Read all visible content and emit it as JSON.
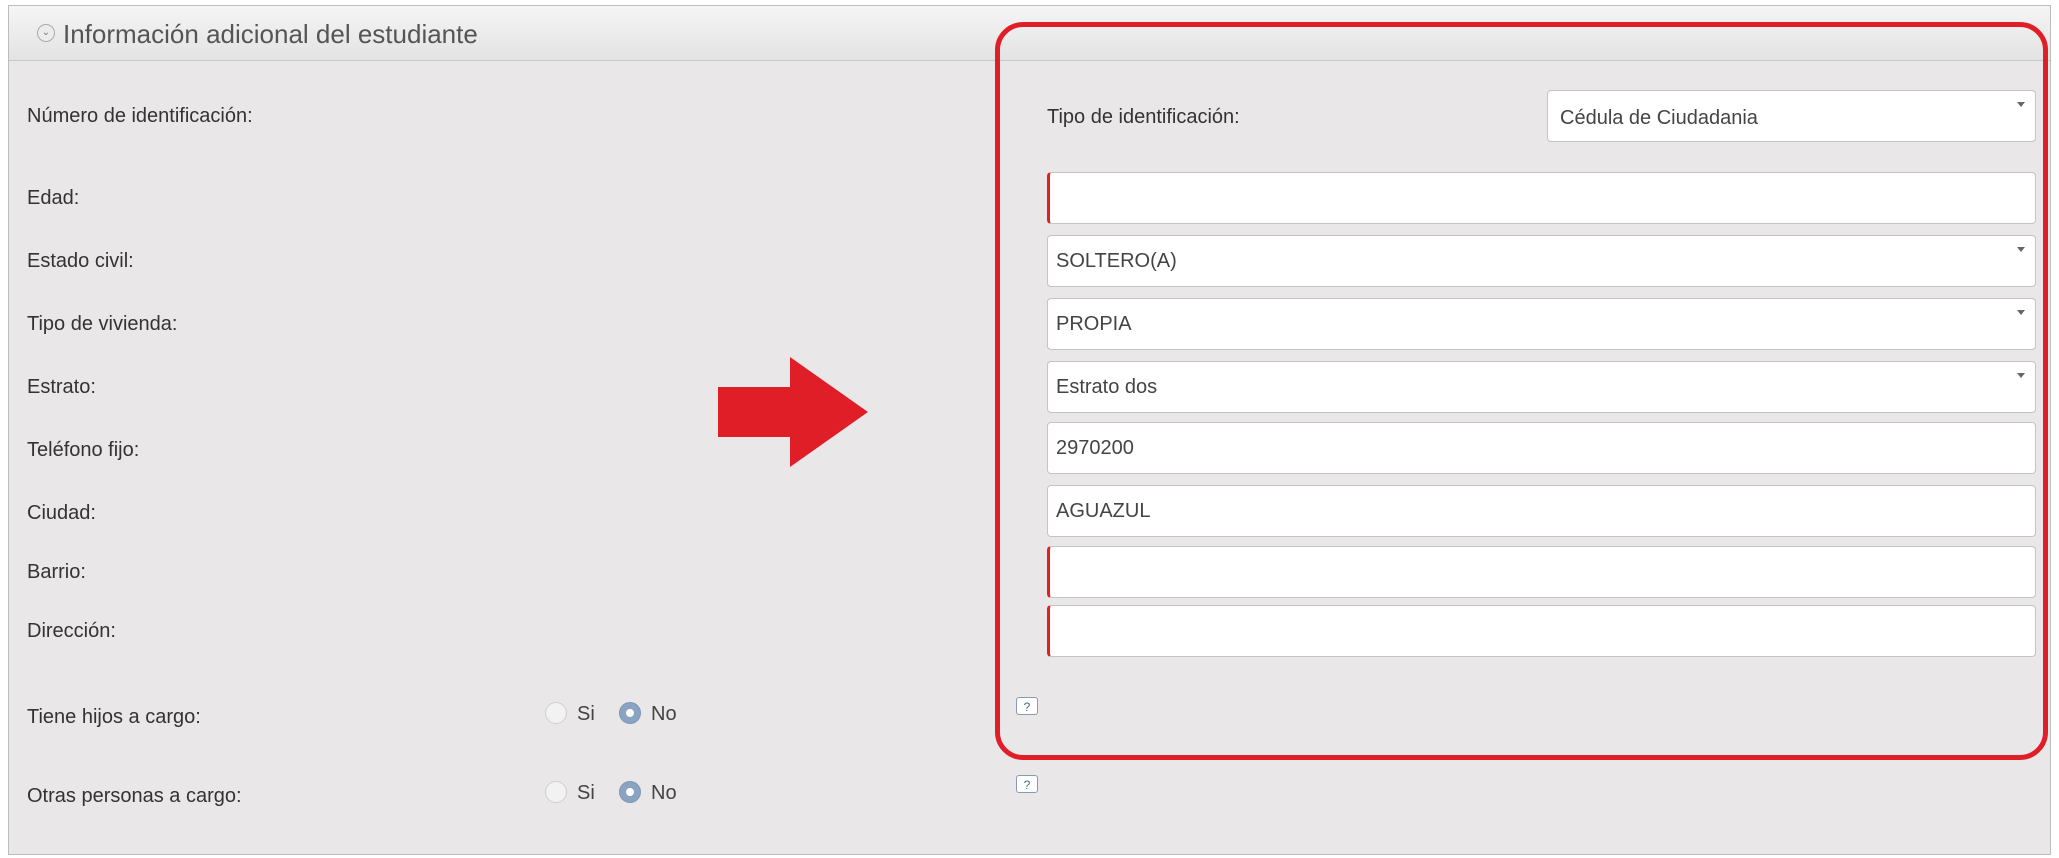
{
  "panel": {
    "title": "Información adicional del estudiante",
    "collapse_icon": "chevron-down-icon"
  },
  "labels": {
    "numero_id": "Número de identificación:",
    "edad": "Edad:",
    "estado_civil": "Estado civil:",
    "tipo_vivienda": "Tipo de vivienda:",
    "estrato": "Estrato:",
    "telefono_fijo": "Teléfono fijo:",
    "ciudad": "Ciudad:",
    "barrio": "Barrio:",
    "direccion": "Dirección:",
    "tiene_hijos": "Tiene hijos a cargo:",
    "otras_personas": "Otras personas a cargo:",
    "tipo_id": "Tipo de identificación:"
  },
  "fields": {
    "tipo_id": "Cédula de Ciudadania",
    "numero_id": "",
    "estado_civil": "SOLTERO(A)",
    "tipo_vivienda": "PROPIA",
    "estrato": "Estrato dos",
    "telefono_fijo": "2970200",
    "ciudad": "AGUAZUL",
    "barrio": "",
    "direccion": ""
  },
  "radios": {
    "si": "Si",
    "no": "No",
    "tiene_hijos_selected": "No",
    "otras_personas_selected": "No"
  },
  "help_icon": "help-icon",
  "colors": {
    "highlight": "#e01e28",
    "arrow": "#e01e28",
    "required_marker": "#e02020",
    "radio_selected": "#8aa3c0"
  }
}
